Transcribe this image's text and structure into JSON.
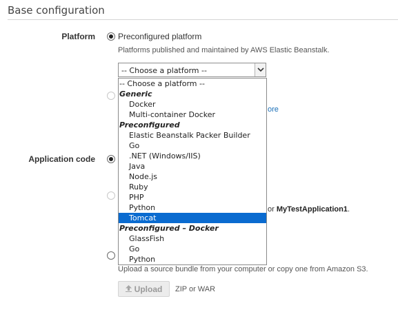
{
  "section": {
    "title": "Base configuration"
  },
  "platform": {
    "label": "Platform",
    "preconfigured_label": "Preconfigured platform",
    "help": "Platforms published and maintained by AWS Elastic Beanstalk.",
    "select_value": "-- Choose a platform --",
    "partial_link": "ore"
  },
  "dropdown": {
    "items": [
      {
        "kind": "placeholder",
        "label": "-- Choose a platform --"
      },
      {
        "kind": "group",
        "label": "Generic"
      },
      {
        "kind": "option",
        "label": "Docker"
      },
      {
        "kind": "option",
        "label": "Multi-container Docker"
      },
      {
        "kind": "group",
        "label": "Preconfigured"
      },
      {
        "kind": "option",
        "label": "Elastic Beanstalk Packer Builder"
      },
      {
        "kind": "option",
        "label": "Go"
      },
      {
        "kind": "option",
        "label": ".NET (Windows/IIS)"
      },
      {
        "kind": "option",
        "label": "Java"
      },
      {
        "kind": "option",
        "label": "Node.js"
      },
      {
        "kind": "option",
        "label": "Ruby"
      },
      {
        "kind": "option",
        "label": "PHP"
      },
      {
        "kind": "option",
        "label": "Python"
      },
      {
        "kind": "option",
        "label": "Tomcat",
        "selected": true
      },
      {
        "kind": "group",
        "label": "Preconfigured – Docker"
      },
      {
        "kind": "option",
        "label": "GlassFish"
      },
      {
        "kind": "option",
        "label": "Go"
      },
      {
        "kind": "option",
        "label": "Python"
      }
    ]
  },
  "application_code": {
    "label": "Application code",
    "sample_text_prefix": "or",
    "sample_app_name": "MyTestApplication1",
    "sample_text_suffix": ".",
    "upload_help": "Upload a source bundle from your computer or copy one from Amazon S3.",
    "upload_button": "Upload",
    "upload_hint": "ZIP or WAR"
  },
  "icons": {
    "select": "chevron-down-icon",
    "upload": "upload-arrow-icon"
  },
  "colors": {
    "selected_option": "#0a6bd0",
    "link": "#1a6fb8"
  }
}
